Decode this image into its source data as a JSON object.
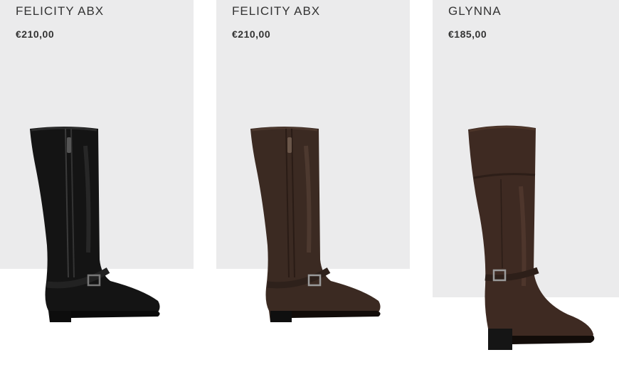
{
  "products": [
    {
      "name": "FELICITY ABX",
      "price": "€210,00",
      "color": "#1a1a1a",
      "icon": "black-tall-boot-image"
    },
    {
      "name": "FELICITY ABX",
      "price": "€210,00",
      "color": "#3b2a22",
      "icon": "brown-tall-boot-image"
    },
    {
      "name": "GLYNNA",
      "price": "€185,00",
      "color": "#3e2a22",
      "icon": "brown-riding-boot-image"
    }
  ]
}
